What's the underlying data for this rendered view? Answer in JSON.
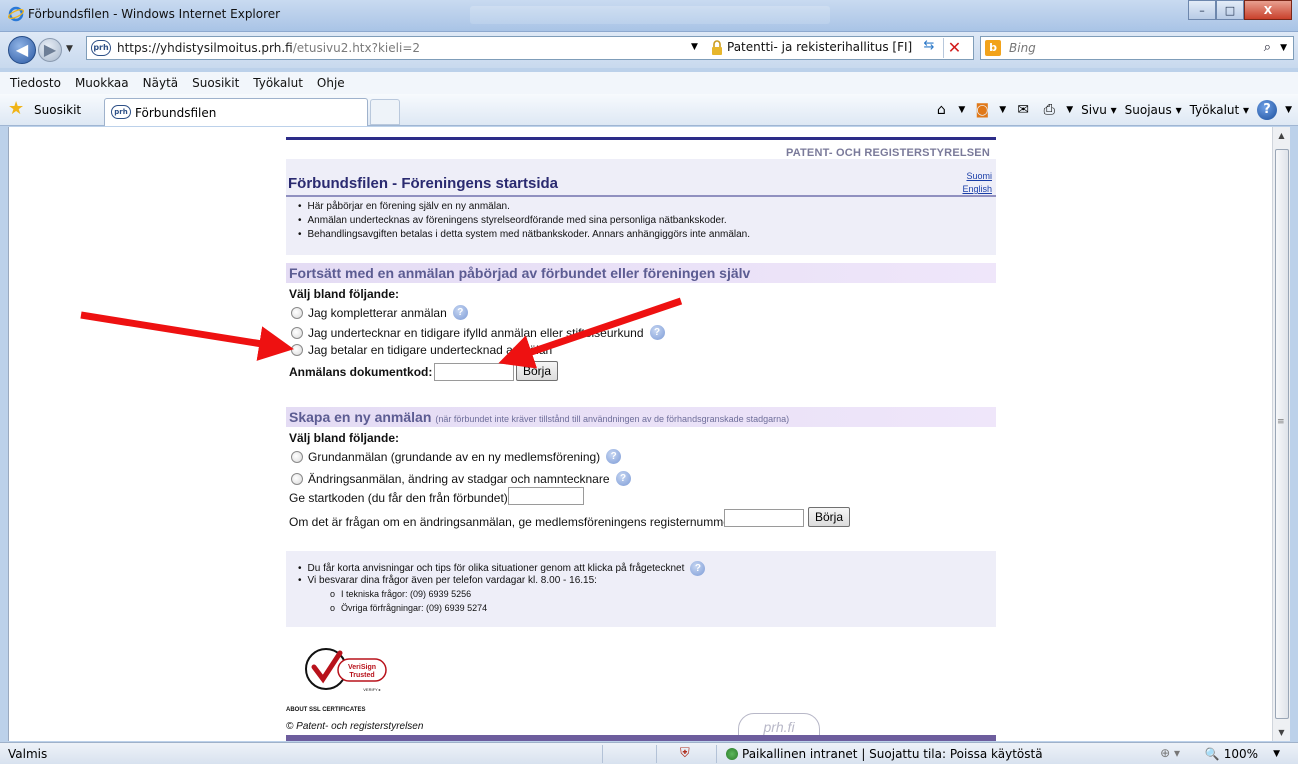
{
  "window": {
    "title": "Förbundsfilen - Windows Internet Explorer",
    "buttons": {
      "minimize": "–",
      "maximize": "□",
      "close": "X"
    }
  },
  "address": {
    "url_main": "https://yhdistysilmoitus.prh.fi",
    "url_rest": "/etusivu2.htx?kieli=2",
    "site_icon": "prh",
    "cert": "Patentti- ja rekisterihallitus [FI]"
  },
  "search": {
    "placeholder": "Bing"
  },
  "menu": [
    "Tiedosto",
    "Muokkaa",
    "Näytä",
    "Suosikit",
    "Työkalut",
    "Ohje"
  ],
  "favbar": {
    "favorites": "Suosikit",
    "tab": "Förbundsfilen",
    "page_menu": "Sivu ▾",
    "safety_menu": "Suojaus ▾",
    "tools_menu": "Työkalut ▾"
  },
  "page": {
    "brand": "PATENT- OCH REGISTERSTYRELSEN",
    "title": "Förbundsfilen - Föreningens startsida",
    "lang_fi": "Suomi",
    "lang_en": "English",
    "intro": [
      "Här påbörjar en förening själv en ny anmälan.",
      "Anmälan undertecknas av föreningens styrelseordförande med sina personliga nätbankskoder.",
      "Behandlingsavgiften betalas i detta system med nätbankskoder. Annars anhängiggörs inte anmälan."
    ],
    "section1": {
      "title": "Fortsätt med en anmälan påbörjad av förbundet eller föreningen själv",
      "choose": "Välj bland följande:",
      "options": [
        "Jag kompletterar anmälan",
        "Jag undertecknar en tidigare ifylld anmälan eller stiftelseurkund",
        "Jag betalar en tidigare undertecknad anmälan"
      ],
      "doc_label": "Anmälans dokumentkod:",
      "doc_value": "",
      "button": "Börja"
    },
    "section2": {
      "title": "Skapa en ny anmälan",
      "subtitle": "(när förbundet inte kräver tillstånd till användningen av de förhandsgranskade stadgarna)",
      "choose": "Välj bland följande:",
      "options": [
        "Grundanmälan (grundande av en ny medlemsförening)",
        "Ändringsanmälan, ändring av stadgar och namntecknare"
      ],
      "start_label": "Ge startkoden (du får den från förbundet):",
      "start_value": "",
      "reg_label": "Om det är frågan om en ändringsanmälan, ge medlemsföreningens registernummer:",
      "reg_value": "",
      "button": "Börja"
    },
    "info": {
      "b1": "Du får korta anvisningar och tips för olika situationer genom att klicka på frågetecknet",
      "b2": "Vi besvarar dina frågor även per telefon vardagar kl. 8.00 - 16.15:",
      "s1": "I tekniska frågor: (09) 6939 5256",
      "s2": "Övriga förfrågningar: (09) 6939 5274"
    },
    "seal": {
      "line1": "VeriSign",
      "line2": "Trusted",
      "line3": "VERIFY ▸",
      "caption": "ABOUT SSL CERTIFICATES"
    },
    "copyright": "© Patent- och registerstyrelsen",
    "footer_logo": "prh.fi"
  },
  "status": {
    "main": "Valmis",
    "zone": "Paikallinen intranet | Suojattu tila: Poissa käytöstä",
    "zoom": "100%"
  },
  "colors": {
    "arrow": "#ee1111",
    "page_title": "#2a2a70",
    "section_bg": "#e4dcf4"
  }
}
